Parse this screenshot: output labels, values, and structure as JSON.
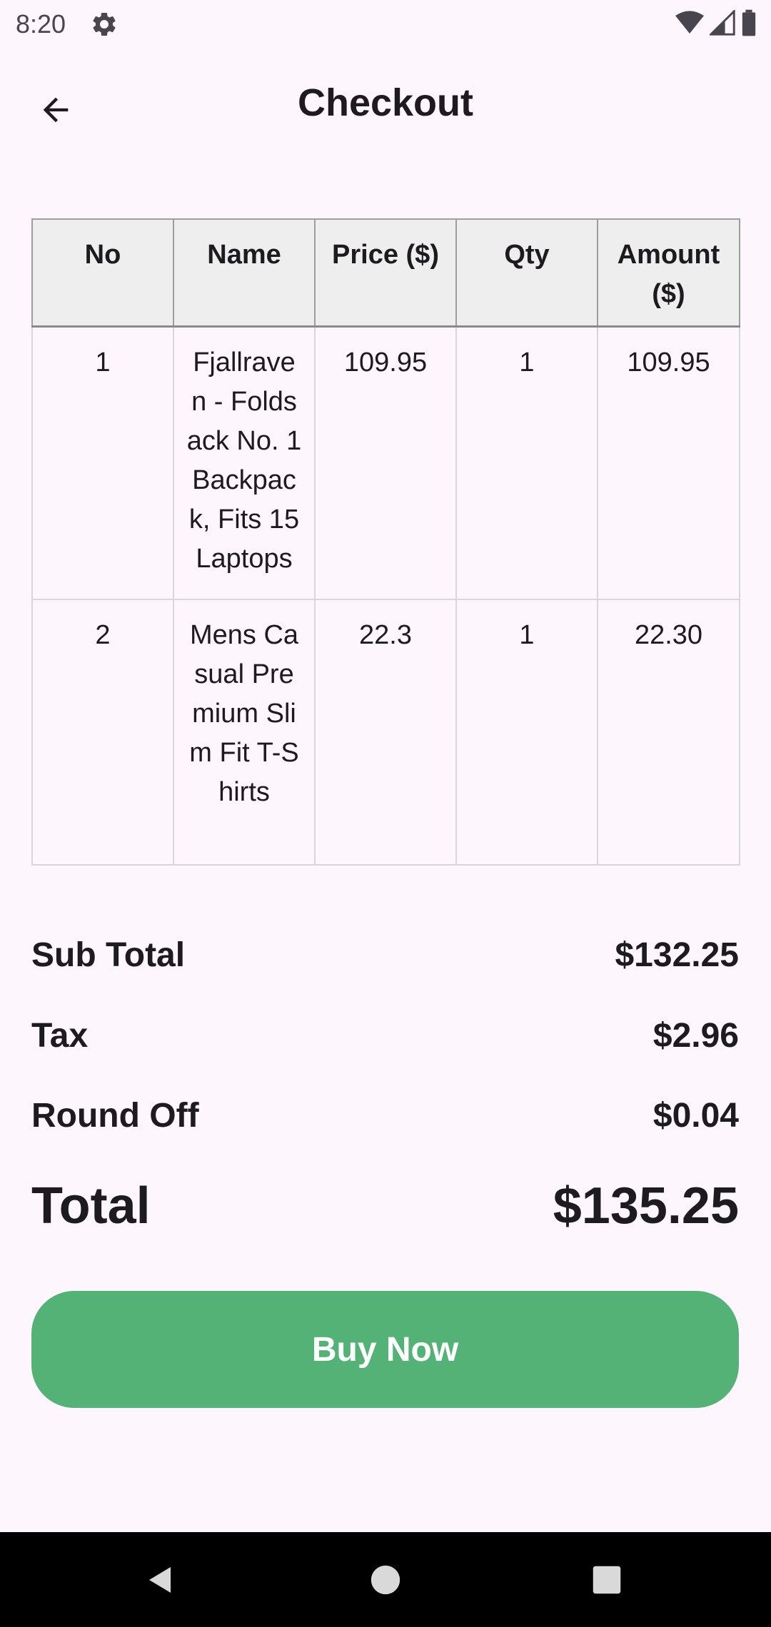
{
  "status_bar": {
    "time": "8:20",
    "icons": [
      "settings-icon",
      "wifi-icon",
      "signal-icon",
      "battery-icon"
    ]
  },
  "app_bar": {
    "title": "Checkout",
    "back_icon": "arrow-back-icon"
  },
  "table": {
    "headers": [
      "No",
      "Name",
      "Price ($)",
      "Qty",
      "Amount ($)"
    ],
    "rows": [
      {
        "no": "1",
        "name": "Fjallraven - Foldsack No. 1 Backpack, Fits 15 Laptops",
        "price": "109.95",
        "qty": "1",
        "amount": "109.95"
      },
      {
        "no": "2",
        "name": "Mens Casual Premium Slim Fit T-Shirts",
        "price": "22.3",
        "qty": "1",
        "amount": "22.30"
      }
    ]
  },
  "summary": {
    "sub_total_label": "Sub Total",
    "sub_total_value": "$132.25",
    "tax_label": "Tax",
    "tax_value": "$2.96",
    "round_off_label": "Round Off",
    "round_off_value": "$0.04",
    "total_label": "Total",
    "total_value": "$135.25"
  },
  "buy_button": {
    "label": "Buy Now",
    "color": "#55b277"
  },
  "nav_bar": {
    "icons": [
      "back-triangle-icon",
      "home-circle-icon",
      "recents-square-icon"
    ]
  }
}
